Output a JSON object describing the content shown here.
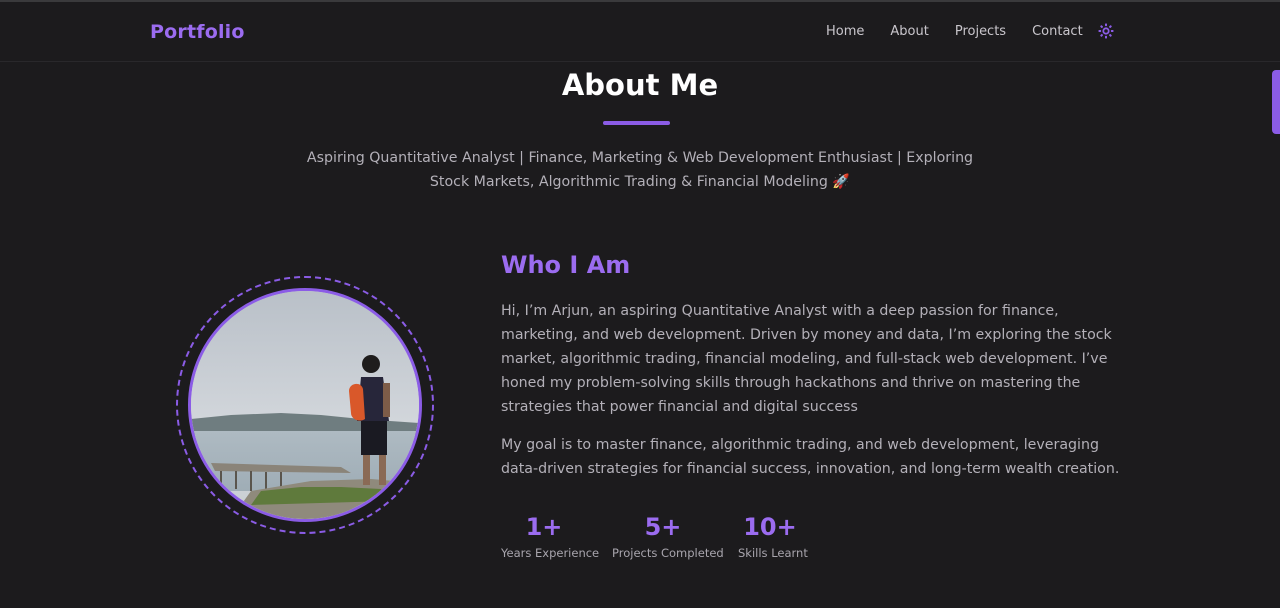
{
  "nav": {
    "logo": "Portfolio",
    "links": [
      "Home",
      "About",
      "Projects",
      "Contact"
    ],
    "theme_toggle_icon": "sun-icon"
  },
  "about": {
    "title": "About Me",
    "subtitle": "Aspiring Quantitative Analyst | Finance, Marketing & Web Development Enthusiast | Exploring Stock Markets, Algorithmic Trading & Financial Modeling 🚀",
    "who_title": "Who I Am",
    "paragraphs": [
      "Hi, I’m Arjun, an aspiring Quantitative Analyst with a deep passion for finance, marketing, and web development. Driven by money and data, I’m exploring the stock market, algorithmic trading, financial modeling, and full-stack web development. I’ve honed my problem-solving skills through hackathons and thrive on mastering the strategies that power financial and digital success",
      "My goal is to master finance, algorithmic trading, and web development, leveraging data-driven strategies for financial success, innovation, and long-term wealth creation."
    ],
    "stats": [
      {
        "value": "1+",
        "label": "Years Experience"
      },
      {
        "value": "5+",
        "label": "Projects Completed"
      },
      {
        "value": "10+",
        "label": "Skills Learnt"
      }
    ]
  },
  "colors": {
    "accent": "#8b5ce6",
    "background": "#1c1b1d",
    "text": "#b3b0b8"
  }
}
